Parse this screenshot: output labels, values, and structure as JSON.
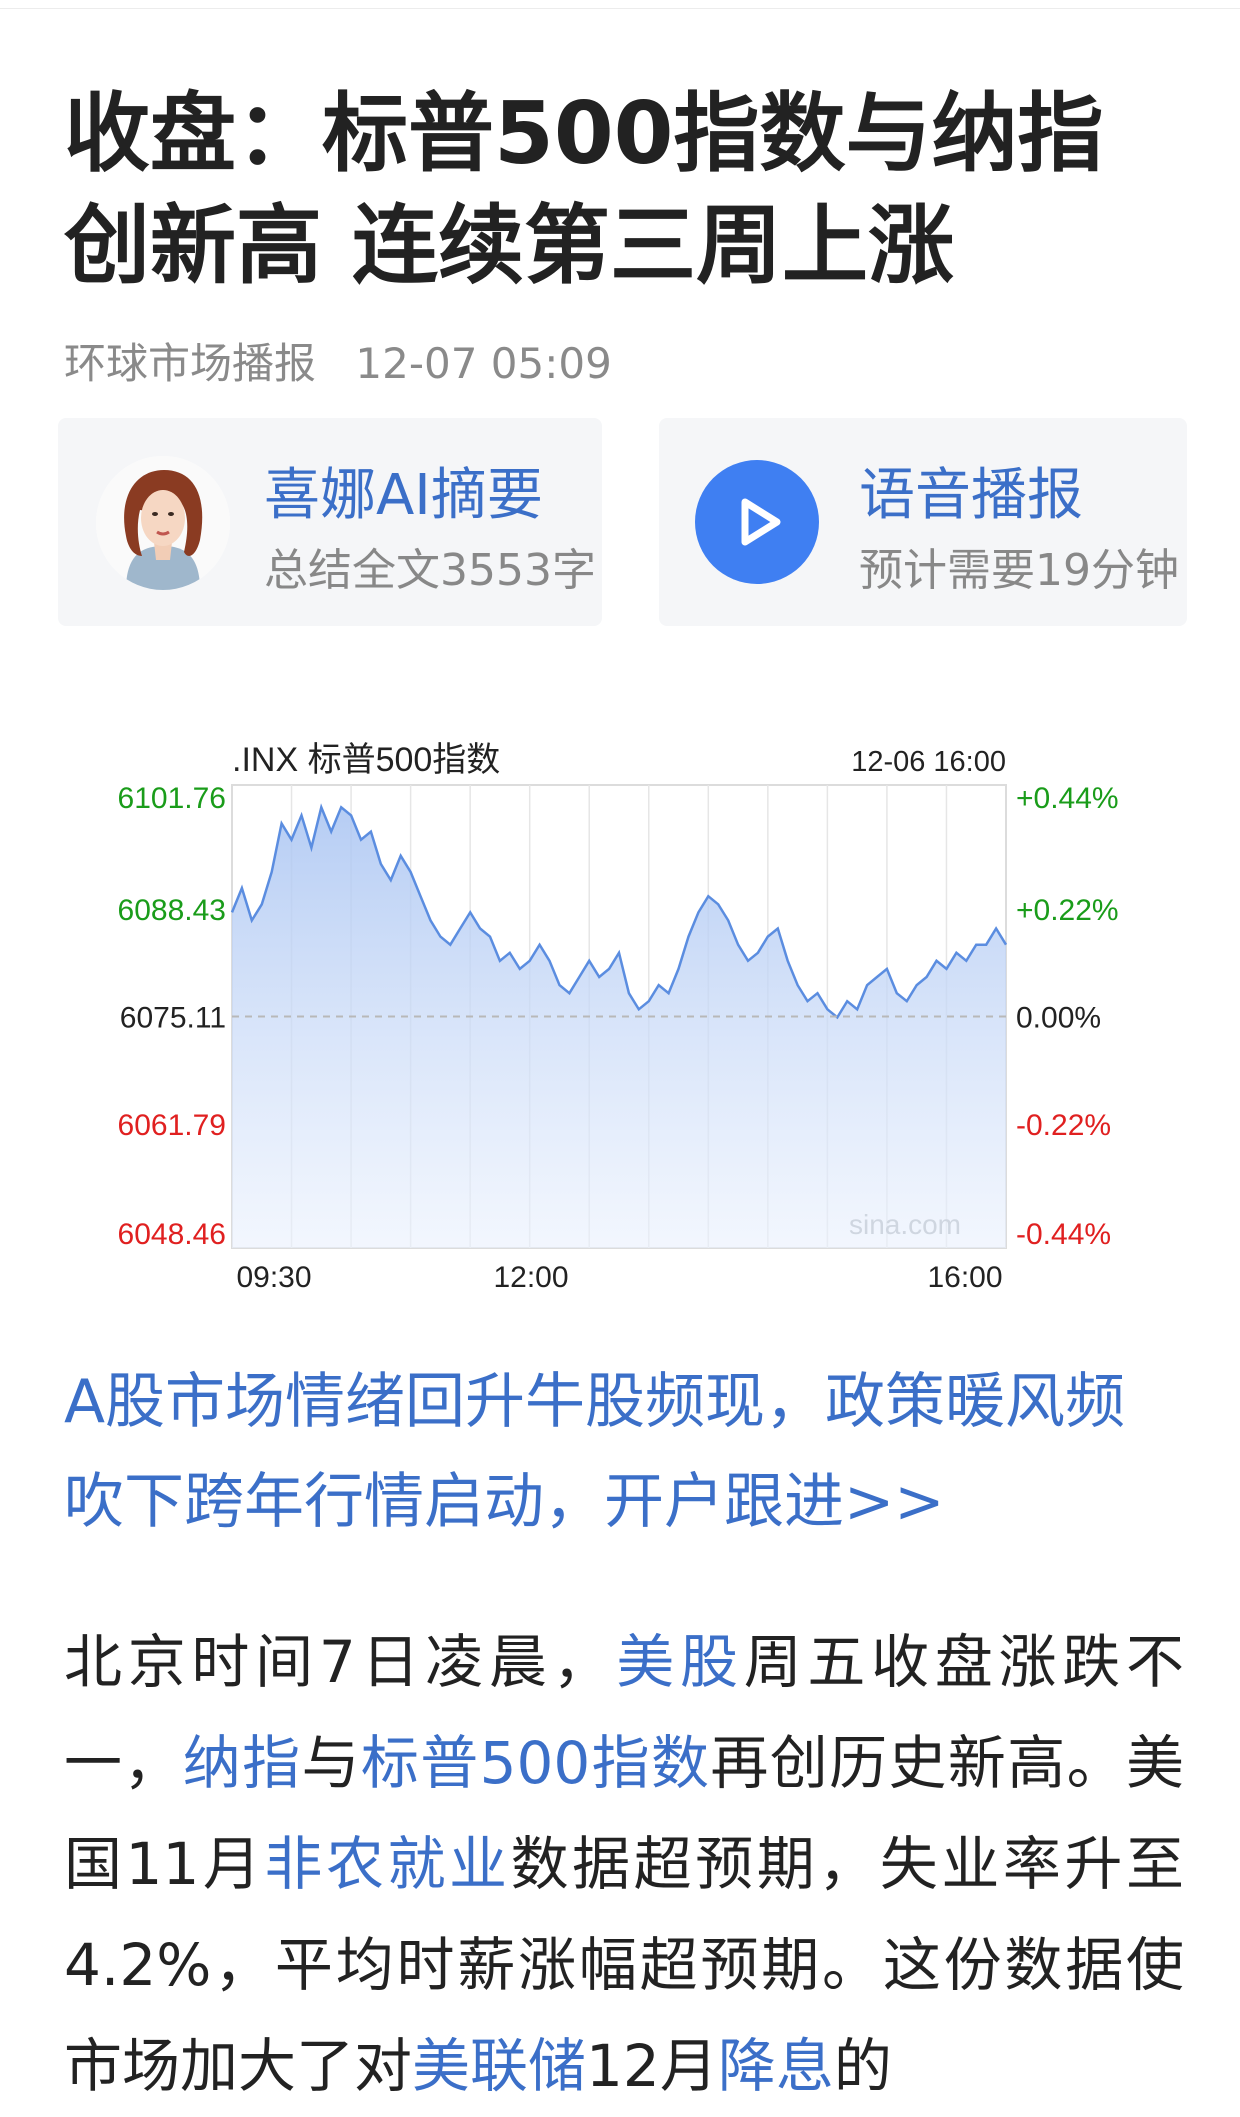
{
  "article": {
    "title_lines": [
      "收盘：标普500指数与纳指",
      "创新高 连续第三周上涨"
    ],
    "source": "环球市场播报",
    "time": "12-07 05:09"
  },
  "ai_card": {
    "title": "喜娜AI摘要",
    "subtitle": "总结全文3553字"
  },
  "audio_card": {
    "title": "语音播报",
    "subtitle": "预计需要19分钟",
    "icon": "play-icon"
  },
  "chart_data": {
    "type": "line",
    "title": ".INX 标普500指数",
    "timestamp": "12-06 16:00",
    "watermark": "sina.com",
    "x_ticks": [
      "09:30",
      "12:00",
      "16:00"
    ],
    "y_left": [
      "6101.76",
      "6088.43",
      "6075.11",
      "6061.79",
      "6048.46"
    ],
    "y_right": [
      "+0.44%",
      "+0.22%",
      "0.00%",
      "-0.22%",
      "-0.44%"
    ],
    "ylim": [
      6048.46,
      6101.76
    ],
    "baseline": 6075.11,
    "series": [
      {
        "values": [
          6088,
          6091,
          6087,
          6089,
          6093,
          6099,
          6097,
          6100,
          6096,
          6101,
          6098,
          6101,
          6100,
          6097,
          6098,
          6094,
          6092,
          6095,
          6093,
          6090,
          6087,
          6085,
          6084,
          6086,
          6088,
          6086,
          6085,
          6082,
          6083,
          6081,
          6082,
          6084,
          6082,
          6079,
          6078,
          6080,
          6082,
          6080,
          6081,
          6083,
          6078,
          6076,
          6077,
          6079,
          6078,
          6081,
          6085,
          6088,
          6090,
          6089,
          6087,
          6084,
          6082,
          6083,
          6085,
          6086,
          6082,
          6079,
          6077,
          6078,
          6076,
          6075,
          6077,
          6076,
          6079,
          6080,
          6081,
          6078,
          6077,
          6079,
          6080,
          6082,
          6081,
          6083,
          6082,
          6084,
          6084,
          6086,
          6084
        ]
      }
    ],
    "colors": {
      "up": "#1a9c1a",
      "down": "#e02020",
      "line": "#5b8de0",
      "neutral": "#222222"
    }
  },
  "promo": {
    "text": "A股市场情绪回升牛股频现，政策暖风频吹下跨年行情启动，开户跟进>>",
    "color": "#3b6fc8"
  },
  "body": {
    "segments": [
      {
        "text": "北京时间7日凌晨，",
        "link": false
      },
      {
        "text": "美股",
        "link": true
      },
      {
        "text": "周五收盘涨跌不一，",
        "link": false
      },
      {
        "text": "纳指",
        "link": true
      },
      {
        "text": "与",
        "link": false
      },
      {
        "text": "标普500指数",
        "link": true
      },
      {
        "text": "再创历史新高。美国11月",
        "link": false
      },
      {
        "text": "非农就业",
        "link": true
      },
      {
        "text": "数据超预期，失业率升至4.2%，平均时薪涨幅超预期。这份数据使市场加大了对",
        "link": false
      },
      {
        "text": "美联储",
        "link": true
      },
      {
        "text": "12月",
        "link": false
      },
      {
        "text": "降息",
        "link": true
      },
      {
        "text": "的",
        "link": false
      }
    ]
  }
}
